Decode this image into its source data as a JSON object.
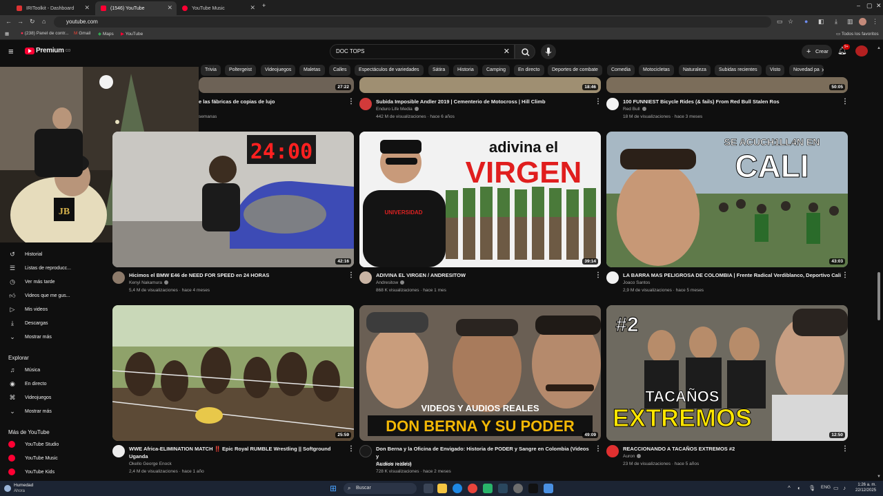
{
  "browser": {
    "tabs": [
      {
        "title": "IRIToolkit - Dashboard"
      },
      {
        "title": "(1546) YouTube"
      },
      {
        "title": "YouTube Music"
      }
    ],
    "url": "youtube.com",
    "bookmarks": [
      "(238) Panel de contr...",
      "Gmail",
      "Maps",
      "YouTube"
    ],
    "all_favorites": "Todos los favoritos"
  },
  "header": {
    "logo": "Premium",
    "logo_cc": "CO",
    "search_value": "DOC TOPS",
    "create_label": "Crear",
    "notif_count": "9+"
  },
  "chips": [
    "Trivia",
    "Poltergeist",
    "Videojuegos",
    "Maletas",
    "Calles",
    "Espectáculos de variedades",
    "Sátira",
    "Historia",
    "Camping",
    "En directo",
    "Deportes de combate",
    "Comedia",
    "Motocicletas",
    "Naturaleza",
    "Subidas recientes",
    "Visto",
    "Novedad pa"
  ],
  "sidebar": {
    "you_items": [
      {
        "label": "Historial",
        "icon": "history-icon"
      },
      {
        "label": "Listas de reproducc...",
        "icon": "playlist-icon"
      },
      {
        "label": "Ver más tarde",
        "icon": "clock-icon"
      },
      {
        "label": "Videos que me gus...",
        "icon": "thumbs-up-icon"
      },
      {
        "label": "Mis videos",
        "icon": "play-icon"
      },
      {
        "label": "Descargas",
        "icon": "download-icon"
      },
      {
        "label": "Mostrar más",
        "icon": "chevron-down-icon"
      }
    ],
    "explore_title": "Explorar",
    "explore_items": [
      {
        "label": "Música",
        "icon": "music-icon"
      },
      {
        "label": "En directo",
        "icon": "live-icon"
      },
      {
        "label": "Videojuegos",
        "icon": "gamepad-icon"
      },
      {
        "label": "Mostrar más",
        "icon": "chevron-down-icon"
      }
    ],
    "more_title": "Más de YouTube",
    "more_items": [
      {
        "label": "YouTube Studio"
      },
      {
        "label": "YouTube Music"
      },
      {
        "label": "YouTube Kids"
      }
    ]
  },
  "videos": {
    "row0": [
      {
        "title": "e las fábricas de copias de lujo",
        "channel": "",
        "meta": "semanas",
        "duration": "27:22"
      },
      {
        "title": "Subida Imposible Andler 2019 | Cementerio de Motocross | Hill Climb",
        "channel": "Enduro Life Media",
        "meta": "442 M de visualizaciones · hace 6 años",
        "duration": "18:46"
      },
      {
        "title": "100 FUNNIEST Bicycle Rides (& fails) From Red Bull Stalen Ros",
        "channel": "Red Bull",
        "meta": "18 M de visualizaciones · hace 3 meses",
        "duration": "50:05"
      }
    ],
    "row1": [
      {
        "title": "Hicimos el BMW E46 de NEED FOR SPEED en 24 HORAS",
        "channel": "Kenyi Nakamura",
        "meta": "5,4 M de visualizaciones · hace 4 meses",
        "duration": "42:16",
        "thumb_text": "24:00"
      },
      {
        "title": "ADIVINA EL VIRGEN / ANDRESITOW",
        "channel": "Andresitow",
        "meta": "868 K visualizaciones · hace 1 mes",
        "duration": "39:14",
        "thumb_text_1": "adivina el",
        "thumb_text_2": "VIRGEN"
      },
      {
        "title": "LA BARRA MAS PELIGROSA DE COLOMBIA | Frente Radical Verdiblanco, Deportivo Cali",
        "channel": "Joaco Santos",
        "meta": "2,9 M de visualizaciones · hace 5 meses",
        "duration": "43:03",
        "thumb_text_1": "SE ACUCH1LL4N EN",
        "thumb_text_2": "CALI"
      }
    ],
    "row2": [
      {
        "title_1": "WWE  Africa-ELIMINATION MATCH ‼️ Epic Royal RUMBLE Wrestling || Softground",
        "title_2": "Uganda",
        "channel": "Okello George Enock",
        "meta": "2,4 M de visualizaciones · hace 1 año",
        "duration": "25:59"
      },
      {
        "title_1": "Don Berna y la Oficina de Envigado: Historia de PODER y Sangre en Colombia  (Videos y",
        "title_2": "Audios reales)",
        "channel": "Canal de la Mafia",
        "meta": "728 K visualizaciones · hace 2 meses",
        "duration": "49:09",
        "thumb_text_1": "VIDEOS Y AUDIOS REALES",
        "thumb_text_2": "DON BERNA Y SU PODER"
      },
      {
        "title_1": "REACCIONANDO A TACAÑOS EXTREMOS #2",
        "title_2": "",
        "channel": "Auron",
        "meta": "23 M de visualizaciones · hace 5 años",
        "duration": "12:50",
        "thumb_text_1": "#2",
        "thumb_text_2": "TACAÑOS",
        "thumb_text_3": "EXTREMOS"
      }
    ]
  },
  "taskbar": {
    "weather_title": "Humedad",
    "weather_sub": "Ahora",
    "search_label": "Buscar",
    "lang": "ENG",
    "time": "1:26 a. m.",
    "date": "22/12/2025"
  },
  "colors": {
    "yt_red": "#ff0033",
    "bg": "#0f0f0f",
    "taskbar": "#1c2433"
  }
}
